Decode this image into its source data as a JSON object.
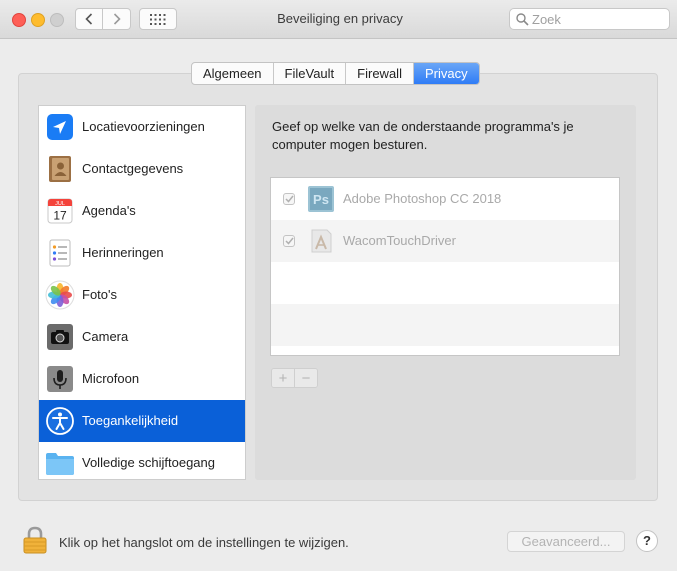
{
  "window": {
    "title": "Beveiliging en privacy",
    "search_placeholder": "Zoek"
  },
  "tabs": [
    {
      "label": "Algemeen",
      "active": false
    },
    {
      "label": "FileVault",
      "active": false
    },
    {
      "label": "Firewall",
      "active": false
    },
    {
      "label": "Privacy",
      "active": true
    }
  ],
  "sidebar": {
    "items": [
      {
        "label": "Locatievoorzieningen",
        "icon": "location-arrow-icon"
      },
      {
        "label": "Contactgegevens",
        "icon": "contacts-book-icon"
      },
      {
        "label": "Agenda's",
        "icon": "calendar-icon",
        "calendar_month": "JUL",
        "calendar_day": "17"
      },
      {
        "label": "Herinneringen",
        "icon": "reminders-list-icon"
      },
      {
        "label": "Foto's",
        "icon": "photos-flower-icon"
      },
      {
        "label": "Camera",
        "icon": "camera-icon"
      },
      {
        "label": "Microfoon",
        "icon": "microphone-icon"
      },
      {
        "label": "Toegankelijkheid",
        "icon": "accessibility-icon",
        "selected": true
      },
      {
        "label": "Volledige schijftoegang",
        "icon": "folder-icon"
      }
    ]
  },
  "main": {
    "description": "Geef op welke van de onderstaande programma's je computer mogen besturen.",
    "apps": [
      {
        "name": "Adobe Photoshop CC 2018",
        "checked": true,
        "icon": "photoshop-icon",
        "icon_text": "Ps"
      },
      {
        "name": "WacomTouchDriver",
        "checked": true,
        "icon": "generic-app-icon"
      }
    ],
    "add_label": "+",
    "remove_label": "−"
  },
  "footer": {
    "lock_text": "Klik op het hangslot om de instellingen te wijzigen.",
    "advanced_label": "Geavanceerd...",
    "help_label": "?"
  },
  "colors": {
    "selection": "#0a60d8",
    "tab_active": "#2f7cf6",
    "traffic_red": "#fe5f57",
    "traffic_yellow": "#febc2e"
  }
}
